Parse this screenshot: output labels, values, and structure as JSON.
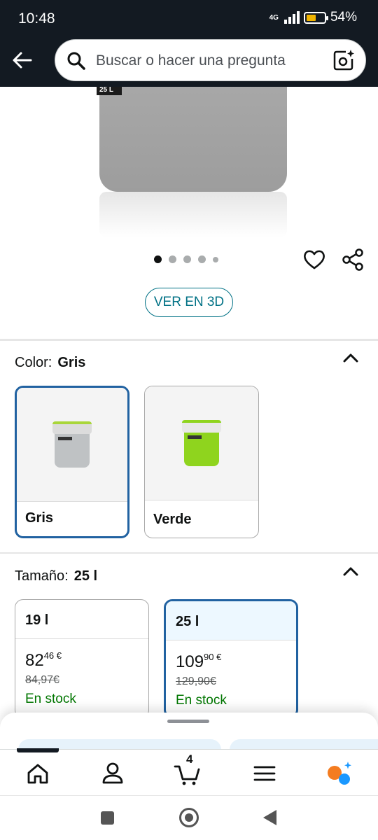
{
  "status_bar": {
    "time": "10:48",
    "network": "4G",
    "battery": "54%",
    "battery_level": 0.54
  },
  "header": {
    "search_placeholder": "Buscar o hacer una pregunta"
  },
  "gallery": {
    "image_label": "25 L",
    "dot_count": 5,
    "active_dot": 0
  },
  "view_3d_label": "VER EN 3D",
  "color_section": {
    "label": "Color:",
    "selected": "Gris",
    "options": [
      {
        "name": "Gris",
        "selected": true,
        "lid_color": "#d7d7d7",
        "body_color": "#b9bcbf",
        "accent": "#a9d63a"
      },
      {
        "name": "Verde",
        "selected": false,
        "lid_color": "#e4e4e4",
        "body_color": "#8fd41e",
        "accent": "#8fd41e"
      }
    ]
  },
  "size_section": {
    "label": "Tamaño:",
    "selected": "25 l",
    "options": [
      {
        "name": "19 l",
        "price_whole": "82",
        "price_fraction": "46 €",
        "old_price": "84,97€",
        "stock": "En stock",
        "selected": false
      },
      {
        "name": "25 l",
        "price_whole": "109",
        "price_fraction": "90 €",
        "old_price": "129,90€",
        "stock": "En stock",
        "selected": true
      }
    ]
  },
  "bottom_nav": {
    "cart_count": "4",
    "items": [
      "home-icon",
      "account-icon",
      "cart-icon",
      "menu-icon",
      "rufus-icon"
    ]
  },
  "colors": {
    "link": "#007185",
    "selected_border": "#2162a1",
    "in_stock": "#007600",
    "header_bg": "#131a22"
  }
}
